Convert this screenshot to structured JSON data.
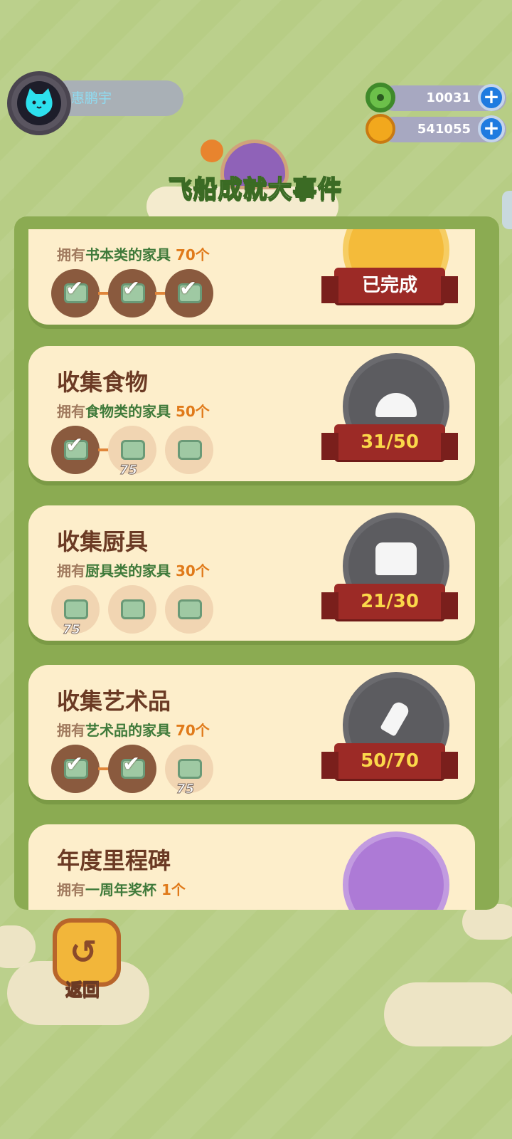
{
  "player": {
    "name": "惠鹏宇"
  },
  "currencies": [
    {
      "name": "green-donut-currency",
      "amount": "10031",
      "color": "#6cc04a"
    },
    {
      "name": "gold-coin-currency",
      "amount": "541055",
      "color": "#f2a81d"
    }
  ],
  "title": "飞船成就大事件",
  "achievements": [
    {
      "title": "",
      "desc_prefix": "拥有",
      "category": "书本类的家具",
      "target": "70个",
      "steps": [
        "done",
        "done",
        "done"
      ],
      "reward": "",
      "progress": "已完成",
      "medal": "gold"
    },
    {
      "title": "收集食物",
      "desc_prefix": "拥有",
      "category": "食物类的家具",
      "target": "50个",
      "steps": [
        "done",
        "todo",
        "todo"
      ],
      "reward": "75",
      "progress": "31/50",
      "medal": "grey"
    },
    {
      "title": "收集厨具",
      "desc_prefix": "拥有",
      "category": "厨具类的家具",
      "target": "30个",
      "steps": [
        "todo",
        "todo",
        "todo"
      ],
      "reward": "75",
      "progress": "21/30",
      "medal": "grey"
    },
    {
      "title": "收集艺术品",
      "desc_prefix": "拥有",
      "category": "艺术品的家具",
      "target": "70个",
      "steps": [
        "done",
        "done",
        "todo"
      ],
      "reward": "75",
      "progress": "50/70",
      "medal": "grey"
    },
    {
      "title": "年度里程碑",
      "desc_prefix": "拥有",
      "category": "一周年奖杯",
      "target": "1个",
      "steps": [],
      "reward": "",
      "progress": "",
      "medal": "purple"
    }
  ],
  "back_label": "返回"
}
